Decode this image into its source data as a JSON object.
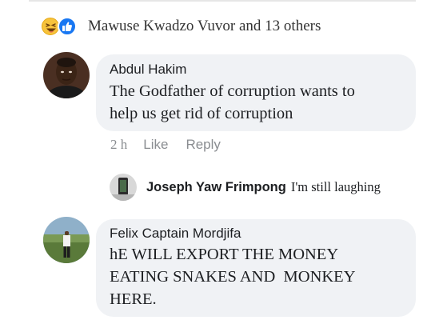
{
  "reactions": {
    "icons": [
      "haha-icon",
      "like-icon"
    ],
    "summary": "Mawuse Kwadzo Vuvor and 13 others"
  },
  "comments": [
    {
      "author": "Abdul Hakim",
      "lines": [
        "The Godfather of corruption wants to",
        "help us get rid of corruption"
      ],
      "time": "2 h",
      "like_label": "Like",
      "reply_label": "Reply"
    },
    {
      "author": "Felix Captain Mordjifa",
      "lines": [
        "hE WILL EXPORT THE MONEY",
        "EATING SNAKES AND  MONKEY",
        "HERE."
      ]
    }
  ],
  "reply": {
    "author": "Joseph Yaw Frimpong",
    "text": "I'm still laughing"
  },
  "colors": {
    "bubble": "#f0f2f5",
    "like_blue": "#1877f2",
    "muted": "#8a8d91"
  }
}
